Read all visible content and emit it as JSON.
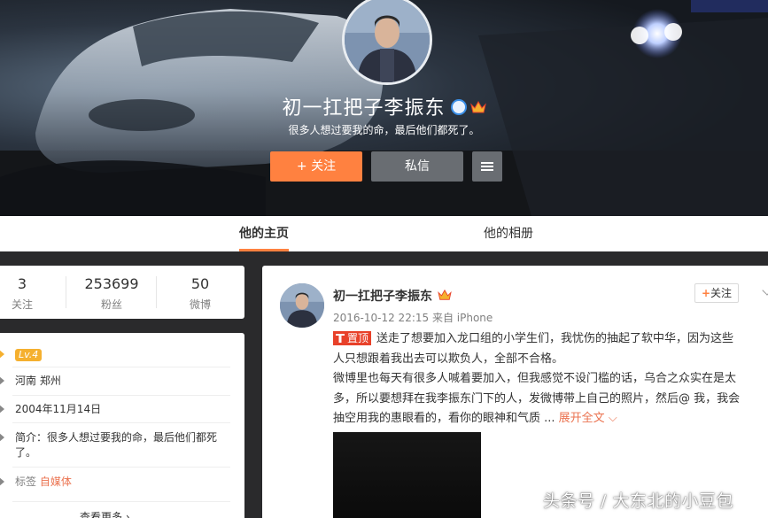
{
  "profile": {
    "name": "初一扛把子李振东",
    "bio": "很多人想过要我的命，最后他们都死了。",
    "follow_label": "+ 关注",
    "message_label": "私信"
  },
  "tabs": [
    {
      "label": "他的主页"
    },
    {
      "label": "他的相册"
    }
  ],
  "stats": [
    {
      "num": "3",
      "label": "关注"
    },
    {
      "num": "253699",
      "label": "粉丝"
    },
    {
      "num": "50",
      "label": "微博"
    }
  ],
  "info": {
    "level": "Lv.4",
    "location": "河南 郑州",
    "birthday": "2004年11月14日",
    "intro": "简介：很多人想过要我的命，最后他们都死了。",
    "tag_label": "标签",
    "tag_value": "自媒体",
    "more": "查看更多 ›"
  },
  "post": {
    "name": "初一扛把子李振东",
    "time": "2016-10-12 22:15 来自 iPhone",
    "follow_label": "关注",
    "pin_label": "置顶",
    "lines": [
      "送走了想要加入龙口组的小学生们，我忧伤的抽起了软中华，因为这些",
      "人只想跟着我出去可以欺负人，全部不合格。",
      "微博里也每天有很多人喊着要加入，但我感觉不设门槛的话，乌合之众实在是太",
      "多，所以要想拜在我李振东门下的人，发微博带上自己的照片，然后@ 我，我会",
      "抽空用我的惠眼看的，看你的眼神和气质 ..."
    ],
    "expand": "展开全文"
  },
  "watermark": "头条号 / 大东北的小豆包",
  "colors": {
    "accent": "#ff8140",
    "link": "#eb7350",
    "pin": "#e8412a"
  }
}
